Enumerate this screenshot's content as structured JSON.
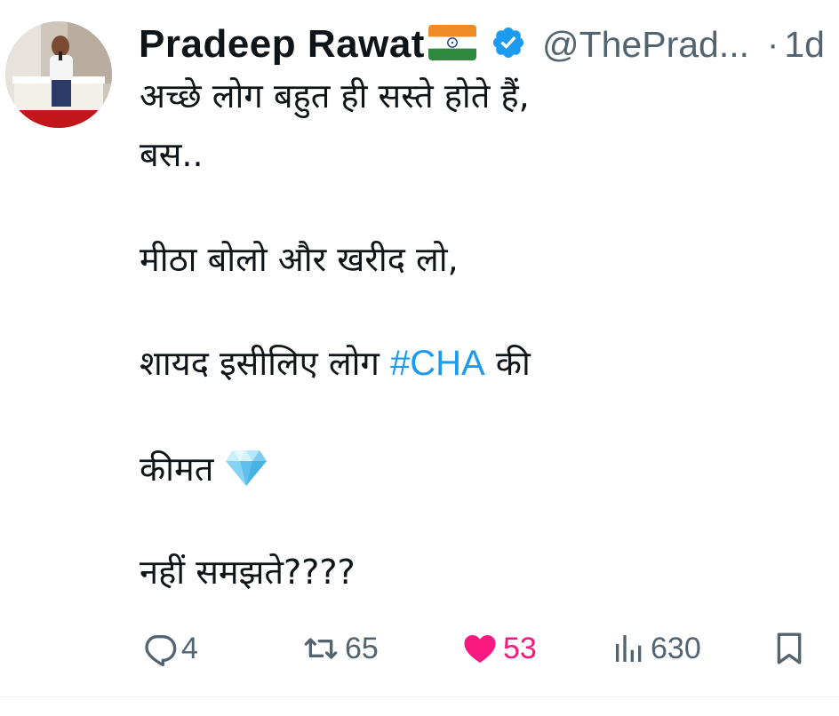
{
  "tweet": {
    "author": {
      "display_name": "Pradeep Rawat",
      "handle": "@ThePrad...",
      "verified": true,
      "flag_icon": "india-flag-icon",
      "verified_icon": "verified-badge-icon",
      "verified_color": "#1d9bf0"
    },
    "separator": "·",
    "time": "1d",
    "lines": [
      "अच्छे लोग बहुत ही सस्ते होते हैं,",
      "बस..",
      "मीठा बोलो और खरीद लो,",
      "शायद इसीलिए लोग",
      "की",
      "कीमत",
      "नहीं समझते????"
    ],
    "hashtag": "#CHA",
    "hashtag_color": "#1d9bf0",
    "emoji_icon": "gem-stone-icon",
    "actions": {
      "replies": "4",
      "retweets": "65",
      "likes": "53",
      "views": "630",
      "liked": true,
      "like_color": "#f91880",
      "icons": [
        "reply-icon",
        "retweet-icon",
        "heart-icon",
        "views-icon",
        "bookmark-icon"
      ]
    }
  }
}
